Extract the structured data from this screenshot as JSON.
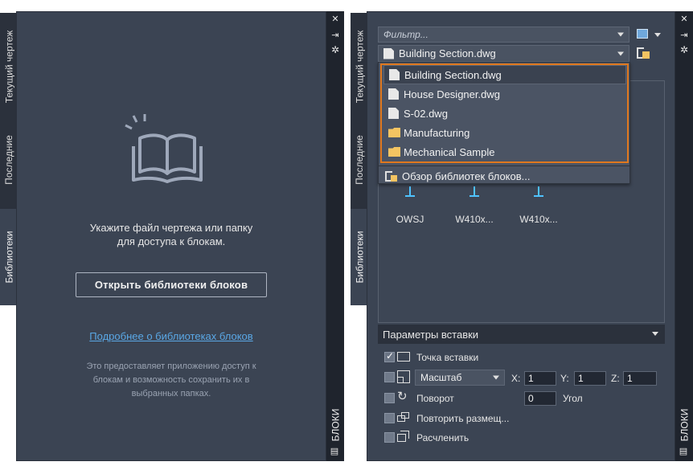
{
  "left_panel": {
    "tabs": {
      "current_drawing": "Текущий чертеж",
      "recent": "Последние",
      "libraries": "Библиотеки"
    },
    "prompt_line1": "Укажите файл чертежа или папку",
    "prompt_line2": "для доступа к блокам.",
    "open_button": "Открыть библиотеки блоков",
    "learn_more_link": "Подробнее о библиотеках блоков",
    "info_line1": "Это предоставляет приложению доступ к",
    "info_line2": "блокам и возможность сохранить их в",
    "info_line3": "выбранных папках.",
    "palette_title": "БЛОКИ"
  },
  "right_panel": {
    "tabs": {
      "current_drawing": "Текущий чертеж",
      "recent": "Последние",
      "libraries": "Библиотеки"
    },
    "filter_placeholder": "Фильтр...",
    "library_selected": "Building Section.dwg",
    "dropdown_items": [
      {
        "label": "Building Section.dwg",
        "type": "file"
      },
      {
        "label": "House Designer.dwg",
        "type": "file"
      },
      {
        "label": "S-02.dwg",
        "type": "file"
      },
      {
        "label": "Manufacturing",
        "type": "folder"
      },
      {
        "label": "Mechanical Sample",
        "type": "folder"
      }
    ],
    "browse_libraries": "Обзор библиотек блоков...",
    "blocks": [
      "OWSJ",
      "W410x...",
      "W410x..."
    ],
    "insert_options": {
      "header": "Параметры вставки",
      "insertion_point": "Точка вставки",
      "scale_label": "Масштаб",
      "x_label": "X:",
      "y_label": "Y:",
      "z_label": "Z:",
      "x_value": "1",
      "y_value": "1",
      "z_value": "1",
      "rotation": "Поворот",
      "rotation_value": "0",
      "angle_label": "Угол",
      "repeat_placement": "Повторить размещ...",
      "explode": "Расчленить"
    },
    "palette_title": "БЛОКИ"
  },
  "colors": {
    "panel_bg": "#3b4453",
    "sidebar_bg": "#1f242d",
    "highlight_border": "#e0781e",
    "link": "#5aa8e6"
  }
}
